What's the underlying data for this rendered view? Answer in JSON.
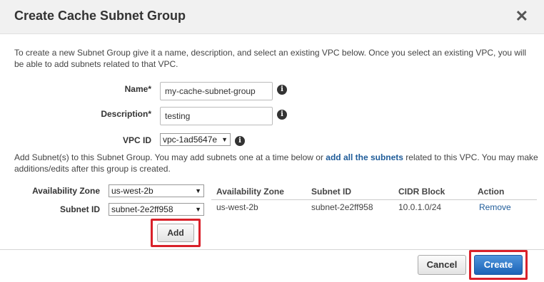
{
  "dialog": {
    "title": "Create Cache Subnet Group",
    "close_icon": "close-icon",
    "intro": "To create a new Subnet Group give it a name, description, and select an existing VPC below. Once you select an existing VPC, you will be able to add subnets related to that VPC."
  },
  "form": {
    "name_label": "Name*",
    "name_value": "my-cache-subnet-group",
    "description_label": "Description*",
    "description_value": "testing",
    "vpc_label": "VPC ID",
    "vpc_value": "vpc-1ad5647e",
    "info_icon_glyph": "i"
  },
  "subnets": {
    "text_before": "Add Subnet(s) to this Subnet Group. You may add subnets one at a time below or ",
    "link": "add all the subnets",
    "text_after": " related to this VPC. You may make additions/edits after this group is created.",
    "az_label": "Availability Zone",
    "az_value": "us-west-2b",
    "subnet_label": "Subnet ID",
    "subnet_value": "subnet-2e2ff958",
    "add_label": "Add"
  },
  "table": {
    "headers": [
      "Availability Zone",
      "Subnet ID",
      "CIDR Block",
      "Action"
    ],
    "rows": [
      {
        "az": "us-west-2b",
        "subnet": "subnet-2e2ff958",
        "cidr": "10.0.1.0/24",
        "action": "Remove"
      }
    ]
  },
  "footer": {
    "cancel_label": "Cancel",
    "create_label": "Create"
  },
  "colors": {
    "highlight_frame": "#d9212a",
    "primary_button": "#1c63b7",
    "link": "#1f5c99"
  }
}
